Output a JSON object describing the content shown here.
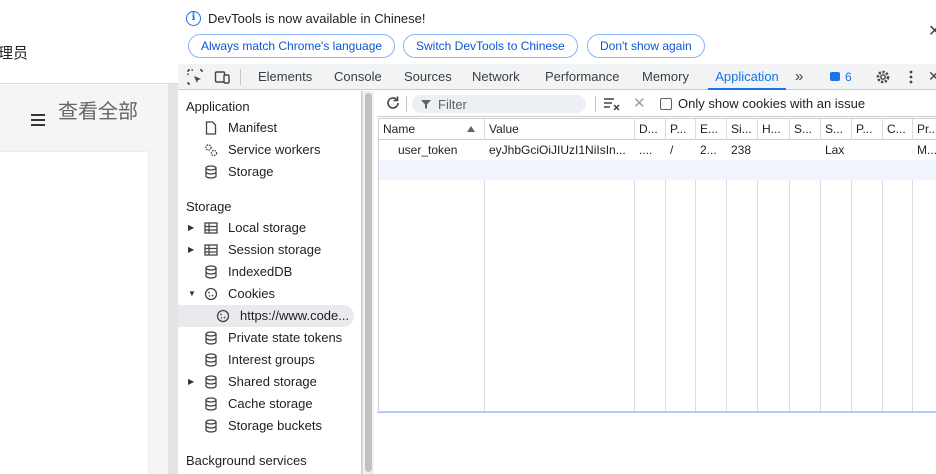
{
  "page": {
    "admin_fragment": "理员",
    "view_all": "查看全部"
  },
  "infobar": {
    "message": "DevTools is now available in Chinese!",
    "buttons": {
      "always_match": "Always match Chrome's language",
      "switch": "Switch DevTools to Chinese",
      "dont_show": "Don't show again"
    }
  },
  "tabs": {
    "elements": "Elements",
    "console": "Console",
    "sources": "Sources",
    "network": "Network",
    "performance": "Performance",
    "memory": "Memory",
    "application": "Application",
    "active": "Application",
    "issues_count": "6"
  },
  "sidebar": {
    "application_header": "Application",
    "application_items": [
      "Manifest",
      "Service workers",
      "Storage"
    ],
    "storage_header": "Storage",
    "storage_items": {
      "local_storage": "Local storage",
      "session_storage": "Session storage",
      "indexeddb": "IndexedDB",
      "cookies": "Cookies",
      "cookie_origin": "https://www.code...",
      "private_state_tokens": "Private state tokens",
      "interest_groups": "Interest groups",
      "shared_storage": "Shared storage",
      "cache_storage": "Cache storage",
      "storage_buckets": "Storage buckets"
    },
    "background_header": "Background services"
  },
  "cookies_toolbar": {
    "filter_placeholder": "Filter",
    "only_issues_label": "Only show cookies with an issue"
  },
  "cookie_table": {
    "columns": [
      "Name",
      "Value",
      "D...",
      "P...",
      "E...",
      "Si...",
      "H...",
      "S...",
      "S...",
      "P...",
      "C...",
      "Pr..."
    ],
    "rows": [
      {
        "name": "user_token",
        "value": "eyJhbGciOiJIUzI1NiIsIn...",
        "domain": "....",
        "path": "/",
        "expires": "2...",
        "size": "238",
        "httponly": "",
        "secure": "",
        "samesite": "Lax",
        "partition_key": "",
        "cross_site": "",
        "priority": "M..."
      }
    ]
  },
  "colors": {
    "accent": "#1a73e8",
    "selected_row": "#f1f6fd",
    "sidebar_selected": "#e8eaed"
  }
}
